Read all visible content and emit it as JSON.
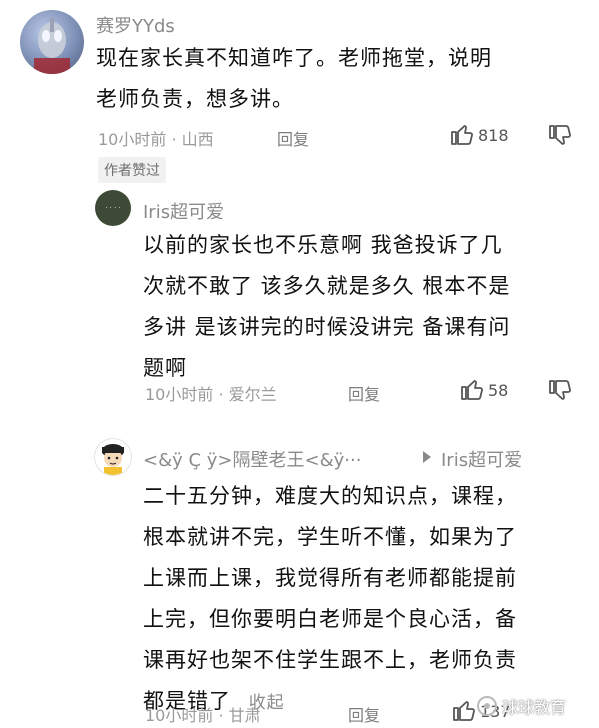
{
  "comments": [
    {
      "username": "赛罗YYds",
      "text": "现在家长真不知道咋了。老师拖堂，说明老师负责，想多讲。",
      "line1": "现在家长真不知道咋了。老师拖堂，说明",
      "line2": "老师负责，想多讲。",
      "time_location": "10小时前 · 山西",
      "reply_label": "回复",
      "likes": "818",
      "badge": "作者赞过",
      "avatar_icon": "ultraman-avatar-icon"
    },
    {
      "username": "Iris超可爱",
      "lines": [
        "以前的家长也不乐意啊 我爸投诉了几",
        "次就不敢了 该多久就是多久 根本不是",
        "多讲 是该讲完的时候没讲完 备课有问",
        "题啊"
      ],
      "time_location": "10小时前 · 爱尔兰",
      "reply_label": "回复",
      "likes": "58",
      "avatar_icon": "green-circle-avatar-icon"
    },
    {
      "username": "<&ÿ Ç ÿ>隔壁老王<&ÿ···",
      "reply_to": "Iris超可爱",
      "lines": [
        "二十五分钟，难度大的知识点，课程，",
        "根本就讲不完，学生听不懂，如果为了",
        "上课而上课，我觉得所有老师都能提前",
        "上完，但你要明白老师是个良心活，备",
        "课再好也架不住学生跟不上，老师负责",
        "都是错了"
      ],
      "collapse_label": "收起",
      "time_location": "10小时前 · 甘肃",
      "reply_label": "回复",
      "likes": "137",
      "avatar_icon": "cartoon-boy-avatar-icon"
    }
  ],
  "watermark": "球球教育",
  "colors": {
    "accent_gray": "#9a9a9a",
    "text": "#111111",
    "green_avatar": "#3c4a36"
  }
}
